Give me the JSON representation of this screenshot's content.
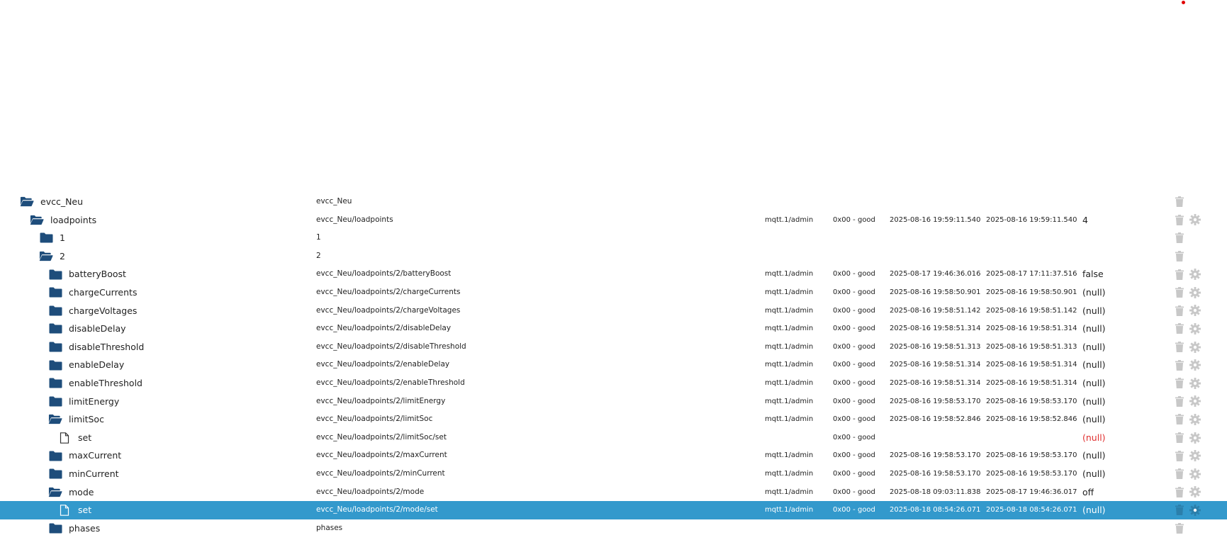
{
  "colors": {
    "selected_bg": "#3399cc",
    "folder": "#1e4d7b",
    "null_error": "#e03030",
    "action_icon": "#c8c8c8",
    "indicator_dot": "#e00000"
  },
  "rows": [
    {
      "level": 0,
      "icon": "folder-open-icon",
      "name": "evcc_Neu",
      "id": "evcc_Neu",
      "role": "",
      "ack": "",
      "ts": "",
      "lc": "",
      "value": "",
      "gear": false
    },
    {
      "level": 1,
      "icon": "folder-open-icon",
      "name": "loadpoints",
      "id": "evcc_Neu/loadpoints",
      "role": "mqtt.1/admin",
      "ack": "0x00 - good",
      "ts": "2025-08-16 19:59:11.540",
      "lc": "2025-08-16 19:59:11.540",
      "value": "4",
      "gear": true
    },
    {
      "level": 2,
      "icon": "folder-icon",
      "name": "1",
      "id": "1",
      "role": "",
      "ack": "",
      "ts": "",
      "lc": "",
      "value": "",
      "gear": false
    },
    {
      "level": 2,
      "icon": "folder-open-icon",
      "name": "2",
      "id": "2",
      "role": "",
      "ack": "",
      "ts": "",
      "lc": "",
      "value": "",
      "gear": false
    },
    {
      "level": 3,
      "icon": "folder-icon",
      "name": "batteryBoost",
      "id": "evcc_Neu/loadpoints/2/batteryBoost",
      "role": "mqtt.1/admin",
      "ack": "0x00 - good",
      "ts": "2025-08-17 19:46:36.016",
      "lc": "2025-08-17 17:11:37.516",
      "value": "false",
      "gear": true
    },
    {
      "level": 3,
      "icon": "folder-icon",
      "name": "chargeCurrents",
      "id": "evcc_Neu/loadpoints/2/chargeCurrents",
      "role": "mqtt.1/admin",
      "ack": "0x00 - good",
      "ts": "2025-08-16 19:58:50.901",
      "lc": "2025-08-16 19:58:50.901",
      "value": "(null)",
      "gear": true
    },
    {
      "level": 3,
      "icon": "folder-icon",
      "name": "chargeVoltages",
      "id": "evcc_Neu/loadpoints/2/chargeVoltages",
      "role": "mqtt.1/admin",
      "ack": "0x00 - good",
      "ts": "2025-08-16 19:58:51.142",
      "lc": "2025-08-16 19:58:51.142",
      "value": "(null)",
      "gear": true
    },
    {
      "level": 3,
      "icon": "folder-icon",
      "name": "disableDelay",
      "id": "evcc_Neu/loadpoints/2/disableDelay",
      "role": "mqtt.1/admin",
      "ack": "0x00 - good",
      "ts": "2025-08-16 19:58:51.314",
      "lc": "2025-08-16 19:58:51.314",
      "value": "(null)",
      "gear": true
    },
    {
      "level": 3,
      "icon": "folder-icon",
      "name": "disableThreshold",
      "id": "evcc_Neu/loadpoints/2/disableThreshold",
      "role": "mqtt.1/admin",
      "ack": "0x00 - good",
      "ts": "2025-08-16 19:58:51.313",
      "lc": "2025-08-16 19:58:51.313",
      "value": "(null)",
      "gear": true
    },
    {
      "level": 3,
      "icon": "folder-icon",
      "name": "enableDelay",
      "id": "evcc_Neu/loadpoints/2/enableDelay",
      "role": "mqtt.1/admin",
      "ack": "0x00 - good",
      "ts": "2025-08-16 19:58:51.314",
      "lc": "2025-08-16 19:58:51.314",
      "value": "(null)",
      "gear": true
    },
    {
      "level": 3,
      "icon": "folder-icon",
      "name": "enableThreshold",
      "id": "evcc_Neu/loadpoints/2/enableThreshold",
      "role": "mqtt.1/admin",
      "ack": "0x00 - good",
      "ts": "2025-08-16 19:58:51.314",
      "lc": "2025-08-16 19:58:51.314",
      "value": "(null)",
      "gear": true
    },
    {
      "level": 3,
      "icon": "folder-icon",
      "name": "limitEnergy",
      "id": "evcc_Neu/loadpoints/2/limitEnergy",
      "role": "mqtt.1/admin",
      "ack": "0x00 - good",
      "ts": "2025-08-16 19:58:53.170",
      "lc": "2025-08-16 19:58:53.170",
      "value": "(null)",
      "gear": true
    },
    {
      "level": 3,
      "icon": "folder-open-icon",
      "name": "limitSoc",
      "id": "evcc_Neu/loadpoints/2/limitSoc",
      "role": "mqtt.1/admin",
      "ack": "0x00 - good",
      "ts": "2025-08-16 19:58:52.846",
      "lc": "2025-08-16 19:58:52.846",
      "value": "(null)",
      "gear": true
    },
    {
      "level": 4,
      "icon": "file-icon",
      "name": "set",
      "id": "evcc_Neu/loadpoints/2/limitSoc/set",
      "role": "",
      "ack": "0x00 - good",
      "ts": "",
      "lc": "",
      "value": "(null)",
      "valueError": true,
      "gear": true
    },
    {
      "level": 3,
      "icon": "folder-icon",
      "name": "maxCurrent",
      "id": "evcc_Neu/loadpoints/2/maxCurrent",
      "role": "mqtt.1/admin",
      "ack": "0x00 - good",
      "ts": "2025-08-16 19:58:53.170",
      "lc": "2025-08-16 19:58:53.170",
      "value": "(null)",
      "gear": true
    },
    {
      "level": 3,
      "icon": "folder-icon",
      "name": "minCurrent",
      "id": "evcc_Neu/loadpoints/2/minCurrent",
      "role": "mqtt.1/admin",
      "ack": "0x00 - good",
      "ts": "2025-08-16 19:58:53.170",
      "lc": "2025-08-16 19:58:53.170",
      "value": "(null)",
      "gear": true
    },
    {
      "level": 3,
      "icon": "folder-open-icon",
      "name": "mode",
      "id": "evcc_Neu/loadpoints/2/mode",
      "role": "mqtt.1/admin",
      "ack": "0x00 - good",
      "ts": "2025-08-18 09:03:11.838",
      "lc": "2025-08-17 19:46:36.017",
      "value": "off",
      "gear": true
    },
    {
      "level": 4,
      "icon": "file-icon",
      "name": "set",
      "id": "evcc_Neu/loadpoints/2/mode/set",
      "role": "mqtt.1/admin",
      "ack": "0x00 - good",
      "ts": "2025-08-18 08:54:26.071",
      "lc": "2025-08-18 08:54:26.071",
      "value": "(null)",
      "gear": true,
      "selected": true
    },
    {
      "level": 3,
      "icon": "folder-icon",
      "name": "phases",
      "id": "phases",
      "role": "",
      "ack": "",
      "ts": "",
      "lc": "",
      "value": "",
      "gear": false
    }
  ]
}
